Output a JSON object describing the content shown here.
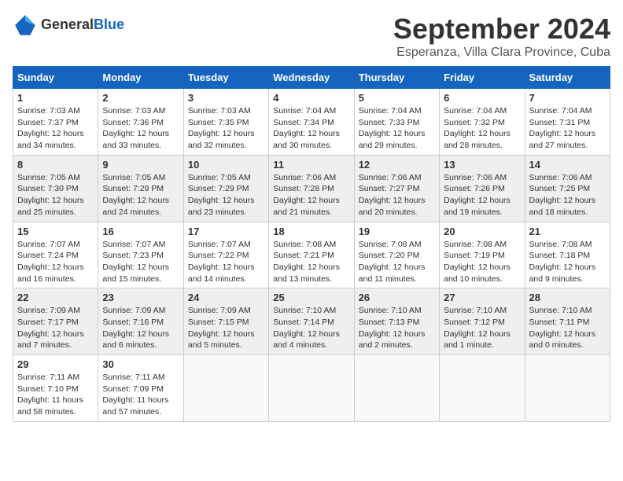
{
  "app": {
    "name": "GeneralBlue",
    "logo_text_1": "General",
    "logo_text_2": "Blue"
  },
  "calendar": {
    "month": "September 2024",
    "location": "Esperanza, Villa Clara Province, Cuba",
    "days_of_week": [
      "Sunday",
      "Monday",
      "Tuesday",
      "Wednesday",
      "Thursday",
      "Friday",
      "Saturday"
    ],
    "weeks": [
      [
        {
          "day": "",
          "info": ""
        },
        {
          "day": "2",
          "info": "Sunrise: 7:03 AM\nSunset: 7:36 PM\nDaylight: 12 hours\nand 33 minutes."
        },
        {
          "day": "3",
          "info": "Sunrise: 7:03 AM\nSunset: 7:35 PM\nDaylight: 12 hours\nand 32 minutes."
        },
        {
          "day": "4",
          "info": "Sunrise: 7:04 AM\nSunset: 7:34 PM\nDaylight: 12 hours\nand 30 minutes."
        },
        {
          "day": "5",
          "info": "Sunrise: 7:04 AM\nSunset: 7:33 PM\nDaylight: 12 hours\nand 29 minutes."
        },
        {
          "day": "6",
          "info": "Sunrise: 7:04 AM\nSunset: 7:32 PM\nDaylight: 12 hours\nand 28 minutes."
        },
        {
          "day": "7",
          "info": "Sunrise: 7:04 AM\nSunset: 7:31 PM\nDaylight: 12 hours\nand 27 minutes."
        }
      ],
      [
        {
          "day": "1",
          "info": "Sunrise: 7:03 AM\nSunset: 7:37 PM\nDaylight: 12 hours\nand 34 minutes."
        },
        {
          "day": "",
          "info": ""
        },
        {
          "day": "",
          "info": ""
        },
        {
          "day": "",
          "info": ""
        },
        {
          "day": "",
          "info": ""
        },
        {
          "day": "",
          "info": ""
        },
        {
          "day": "",
          "info": ""
        }
      ],
      [
        {
          "day": "8",
          "info": "Sunrise: 7:05 AM\nSunset: 7:30 PM\nDaylight: 12 hours\nand 25 minutes."
        },
        {
          "day": "9",
          "info": "Sunrise: 7:05 AM\nSunset: 7:29 PM\nDaylight: 12 hours\nand 24 minutes."
        },
        {
          "day": "10",
          "info": "Sunrise: 7:05 AM\nSunset: 7:29 PM\nDaylight: 12 hours\nand 23 minutes."
        },
        {
          "day": "11",
          "info": "Sunrise: 7:06 AM\nSunset: 7:28 PM\nDaylight: 12 hours\nand 21 minutes."
        },
        {
          "day": "12",
          "info": "Sunrise: 7:06 AM\nSunset: 7:27 PM\nDaylight: 12 hours\nand 20 minutes."
        },
        {
          "day": "13",
          "info": "Sunrise: 7:06 AM\nSunset: 7:26 PM\nDaylight: 12 hours\nand 19 minutes."
        },
        {
          "day": "14",
          "info": "Sunrise: 7:06 AM\nSunset: 7:25 PM\nDaylight: 12 hours\nand 18 minutes."
        }
      ],
      [
        {
          "day": "15",
          "info": "Sunrise: 7:07 AM\nSunset: 7:24 PM\nDaylight: 12 hours\nand 16 minutes."
        },
        {
          "day": "16",
          "info": "Sunrise: 7:07 AM\nSunset: 7:23 PM\nDaylight: 12 hours\nand 15 minutes."
        },
        {
          "day": "17",
          "info": "Sunrise: 7:07 AM\nSunset: 7:22 PM\nDaylight: 12 hours\nand 14 minutes."
        },
        {
          "day": "18",
          "info": "Sunrise: 7:08 AM\nSunset: 7:21 PM\nDaylight: 12 hours\nand 13 minutes."
        },
        {
          "day": "19",
          "info": "Sunrise: 7:08 AM\nSunset: 7:20 PM\nDaylight: 12 hours\nand 11 minutes."
        },
        {
          "day": "20",
          "info": "Sunrise: 7:08 AM\nSunset: 7:19 PM\nDaylight: 12 hours\nand 10 minutes."
        },
        {
          "day": "21",
          "info": "Sunrise: 7:08 AM\nSunset: 7:18 PM\nDaylight: 12 hours\nand 9 minutes."
        }
      ],
      [
        {
          "day": "22",
          "info": "Sunrise: 7:09 AM\nSunset: 7:17 PM\nDaylight: 12 hours\nand 7 minutes."
        },
        {
          "day": "23",
          "info": "Sunrise: 7:09 AM\nSunset: 7:16 PM\nDaylight: 12 hours\nand 6 minutes."
        },
        {
          "day": "24",
          "info": "Sunrise: 7:09 AM\nSunset: 7:15 PM\nDaylight: 12 hours\nand 5 minutes."
        },
        {
          "day": "25",
          "info": "Sunrise: 7:10 AM\nSunset: 7:14 PM\nDaylight: 12 hours\nand 4 minutes."
        },
        {
          "day": "26",
          "info": "Sunrise: 7:10 AM\nSunset: 7:13 PM\nDaylight: 12 hours\nand 2 minutes."
        },
        {
          "day": "27",
          "info": "Sunrise: 7:10 AM\nSunset: 7:12 PM\nDaylight: 12 hours\nand 1 minute."
        },
        {
          "day": "28",
          "info": "Sunrise: 7:10 AM\nSunset: 7:11 PM\nDaylight: 12 hours\nand 0 minutes."
        }
      ],
      [
        {
          "day": "29",
          "info": "Sunrise: 7:11 AM\nSunset: 7:10 PM\nDaylight: 11 hours\nand 58 minutes."
        },
        {
          "day": "30",
          "info": "Sunrise: 7:11 AM\nSunset: 7:09 PM\nDaylight: 11 hours\nand 57 minutes."
        },
        {
          "day": "",
          "info": ""
        },
        {
          "day": "",
          "info": ""
        },
        {
          "day": "",
          "info": ""
        },
        {
          "day": "",
          "info": ""
        },
        {
          "day": "",
          "info": ""
        }
      ]
    ]
  }
}
